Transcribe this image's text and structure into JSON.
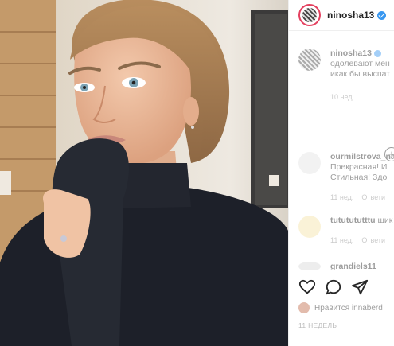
{
  "post": {
    "username": "ninosha13",
    "verified": true,
    "photo_description_icon": "portrait-photo"
  },
  "comments": [
    {
      "user": "ninosha13",
      "text_line1": "одолевают мен",
      "text_line2": "икак бы выспат",
      "time": "10 нед."
    },
    {
      "user": "ourmilstrova_na",
      "text_line1": "Прекрасная! И",
      "text_line2": "Стильная! Здо",
      "time": "11 нед.",
      "reply": "Ответи"
    },
    {
      "user": "tututututttu",
      "text_line1": "шик",
      "time": "11 нед.",
      "reply": "Ответи"
    },
    {
      "user": "grandiels11"
    }
  ],
  "actions": {
    "like_icon": "heart-icon",
    "comment_icon": "comment-icon",
    "share_icon": "share-icon"
  },
  "likes": {
    "text": "Нравится innaberd"
  },
  "date": "11 НЕДЕЛЬ",
  "colors": {
    "accent_ring": "#e4405f",
    "verified": "#3897f0",
    "border": "#efefef",
    "meta": "#8e8e8e"
  }
}
